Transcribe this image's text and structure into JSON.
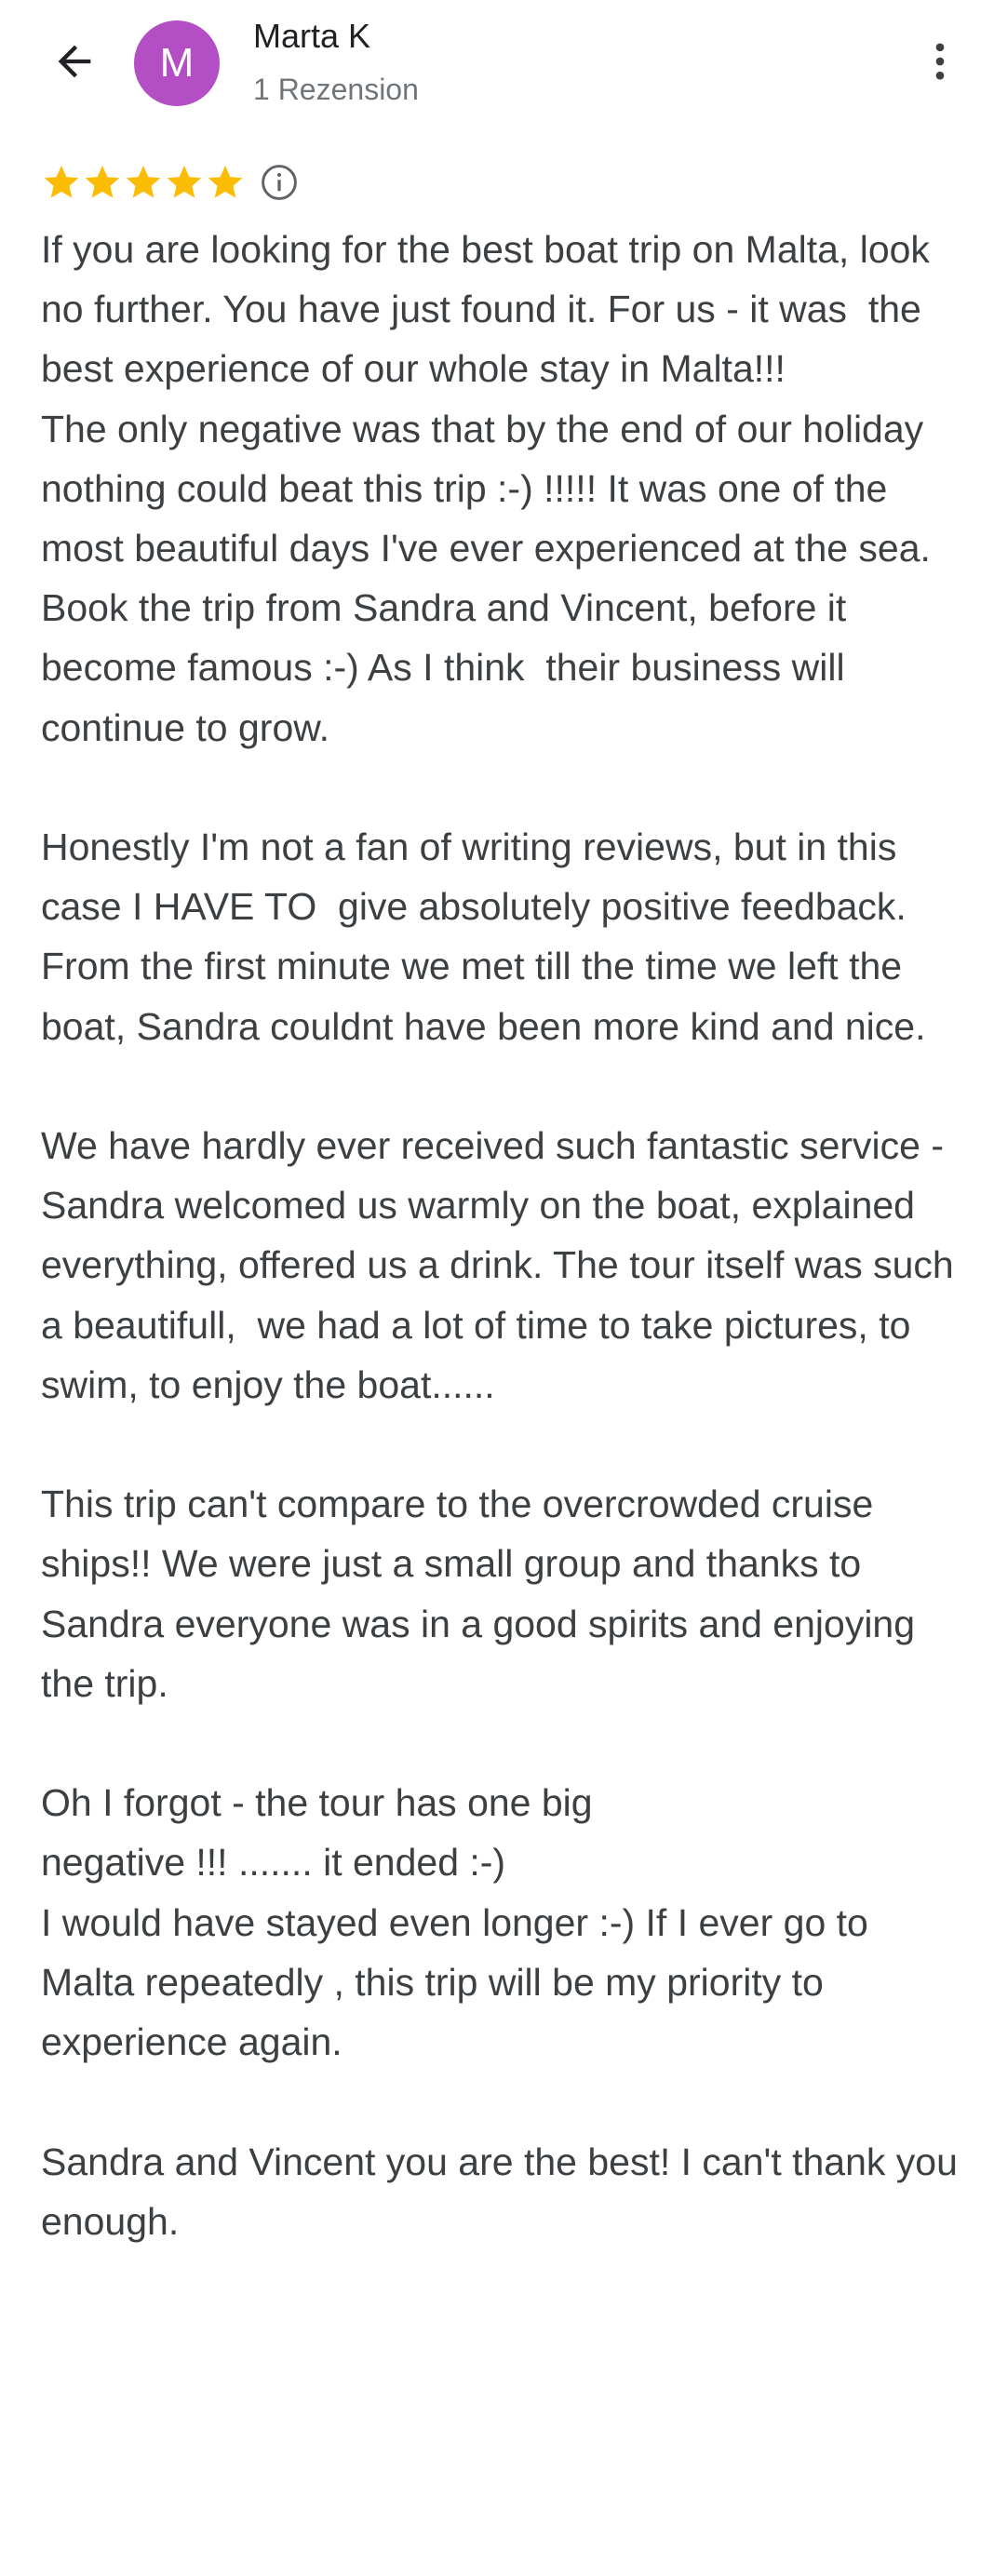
{
  "header": {
    "back_icon": "arrow-left-icon",
    "avatar_letter": "M",
    "avatar_color": "#b34ec5",
    "author_name": "Marta K",
    "review_count": "1 Rezension",
    "more_icon": "more-vert-icon"
  },
  "rating": {
    "stars": 5,
    "max_stars": 5,
    "star_color": "#fbbc04",
    "info_icon": "info-icon"
  },
  "review": {
    "text": "If you are looking for the best boat trip on Malta, look no further. You have just found it. For us - it was  the best experience of our whole stay in Malta!!!\nThe only negative was that by the end of our holiday nothing could beat this trip :-) !!!!! It was one of the most beautiful days I've ever experienced at the sea.\nBook the trip from Sandra and Vincent, before it become famous :-) As I think  their business will continue to grow.\n\nHonestly I'm not a fan of writing reviews, but in this case I HAVE TO  give absolutely positive feedback.\nFrom the first minute we met till the time we left the boat, Sandra couldnt have been more kind and nice.\n\nWe have hardly ever received such fantastic service - Sandra welcomed us warmly on the boat, explained everything, offered us a drink. The tour itself was such a beautifull,  we had a lot of time to take pictures, to swim, to enjoy the boat......\n\nThis trip can't compare to the overcrowded cruise ships!! We were just a small group and thanks to Sandra everyone was in a good spirits and enjoying the trip.\n\nOh I forgot - the tour has one big\nnegative !!! ....... it ended :-)\nI would have stayed even longer :-) If I ever go to Malta repeatedly , this trip will be my priority to experience again.\n\nSandra and Vincent you are the best! I can't thank you enough."
  }
}
